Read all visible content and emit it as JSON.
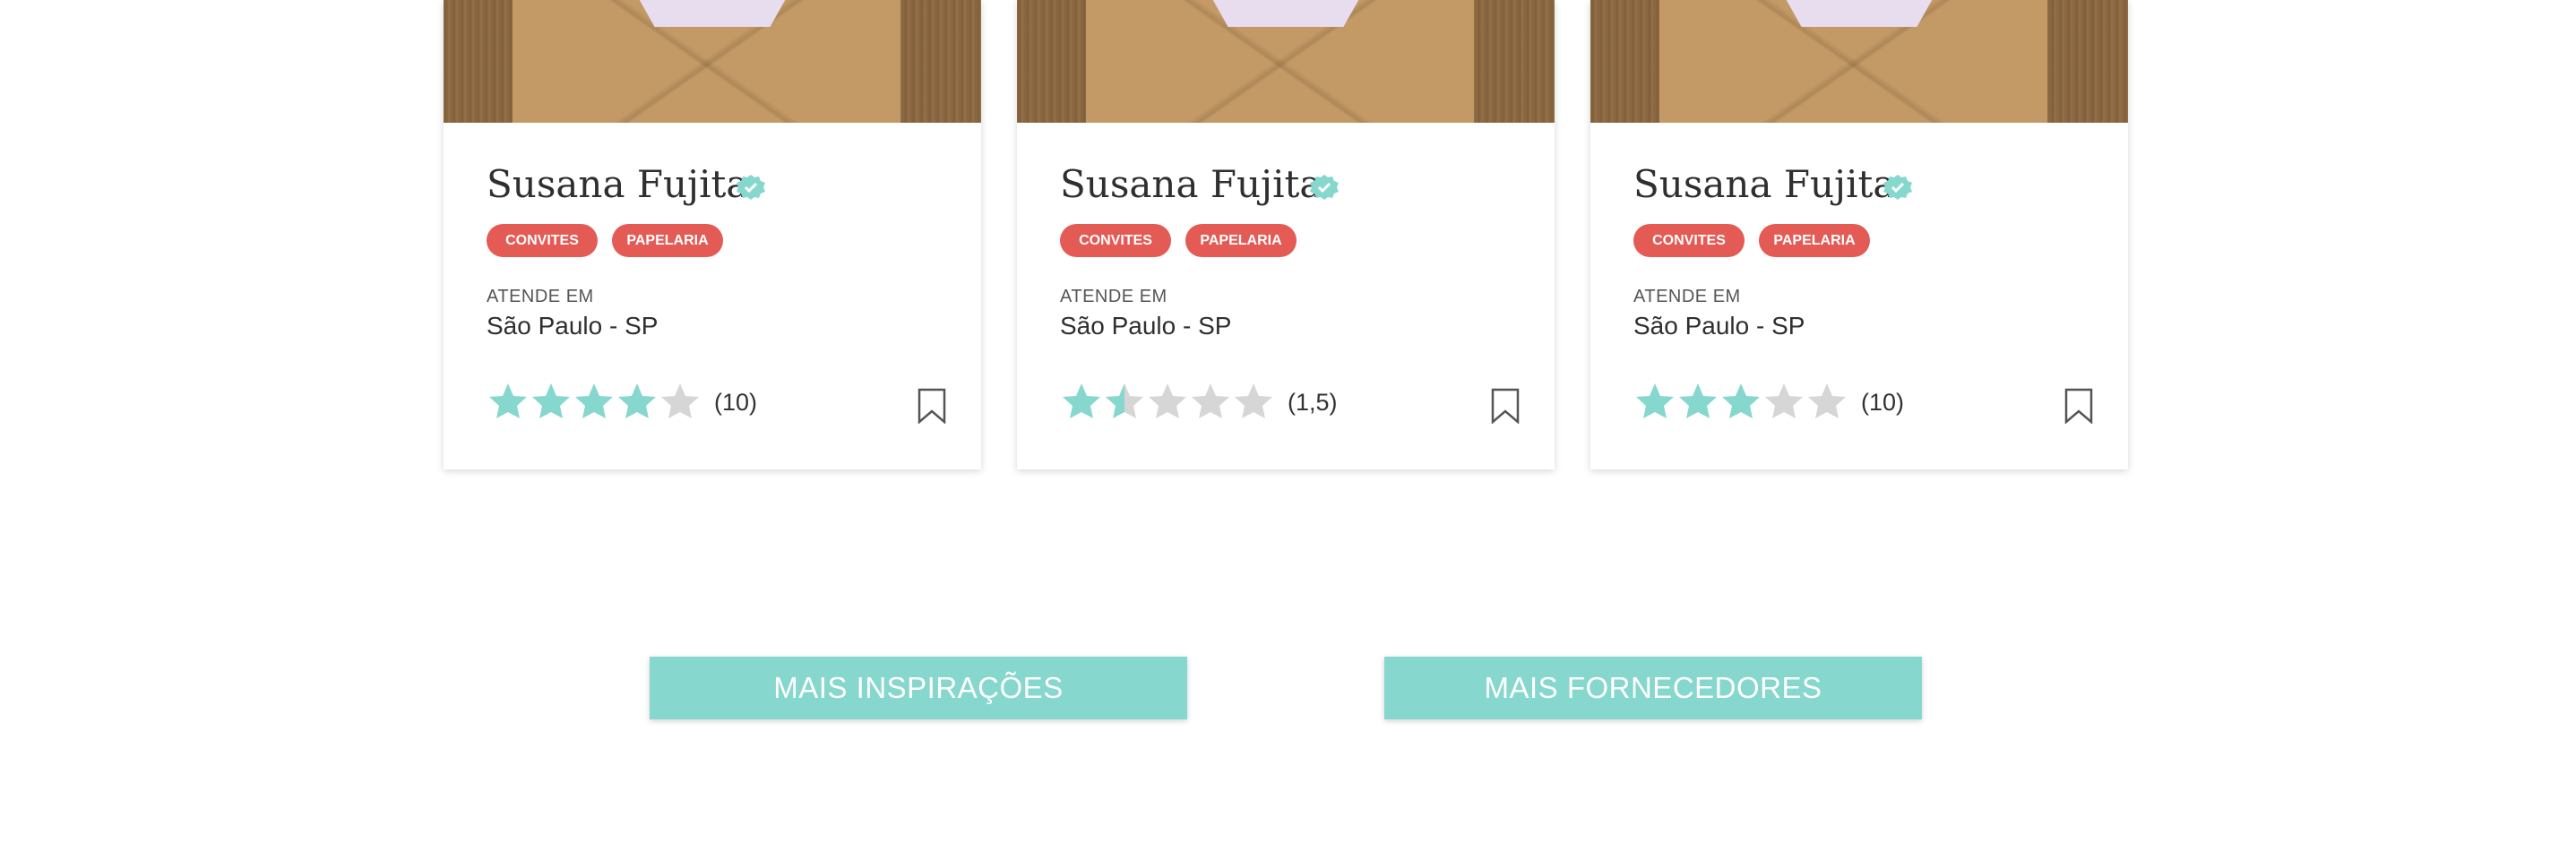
{
  "colors": {
    "accent": "#86d7cd",
    "tag": "#e45a55",
    "star_filled": "#86d7cd",
    "star_empty": "#d6d6d6"
  },
  "cards": [
    {
      "name": "Susana Fujita",
      "tags": [
        "CONVITES",
        "PAPELARIA"
      ],
      "serves_label": "ATENDE EM",
      "location": "São Paulo - SP",
      "stars": 4,
      "rating_count": "(10)"
    },
    {
      "name": "Susana Fujita",
      "tags": [
        "CONVITES",
        "PAPELARIA"
      ],
      "serves_label": "ATENDE EM",
      "location": "São Paulo - SP",
      "stars": 1.5,
      "rating_count": "(1,5)"
    },
    {
      "name": "Susana Fujita",
      "tags": [
        "CONVITES",
        "PAPELARIA"
      ],
      "serves_label": "ATENDE EM",
      "location": "São Paulo - SP",
      "stars": 3,
      "rating_count": "(10)"
    }
  ],
  "buttons": {
    "inspirations": "MAIS INSPIRAÇÕES",
    "suppliers": "MAIS FORNECEDORES"
  }
}
